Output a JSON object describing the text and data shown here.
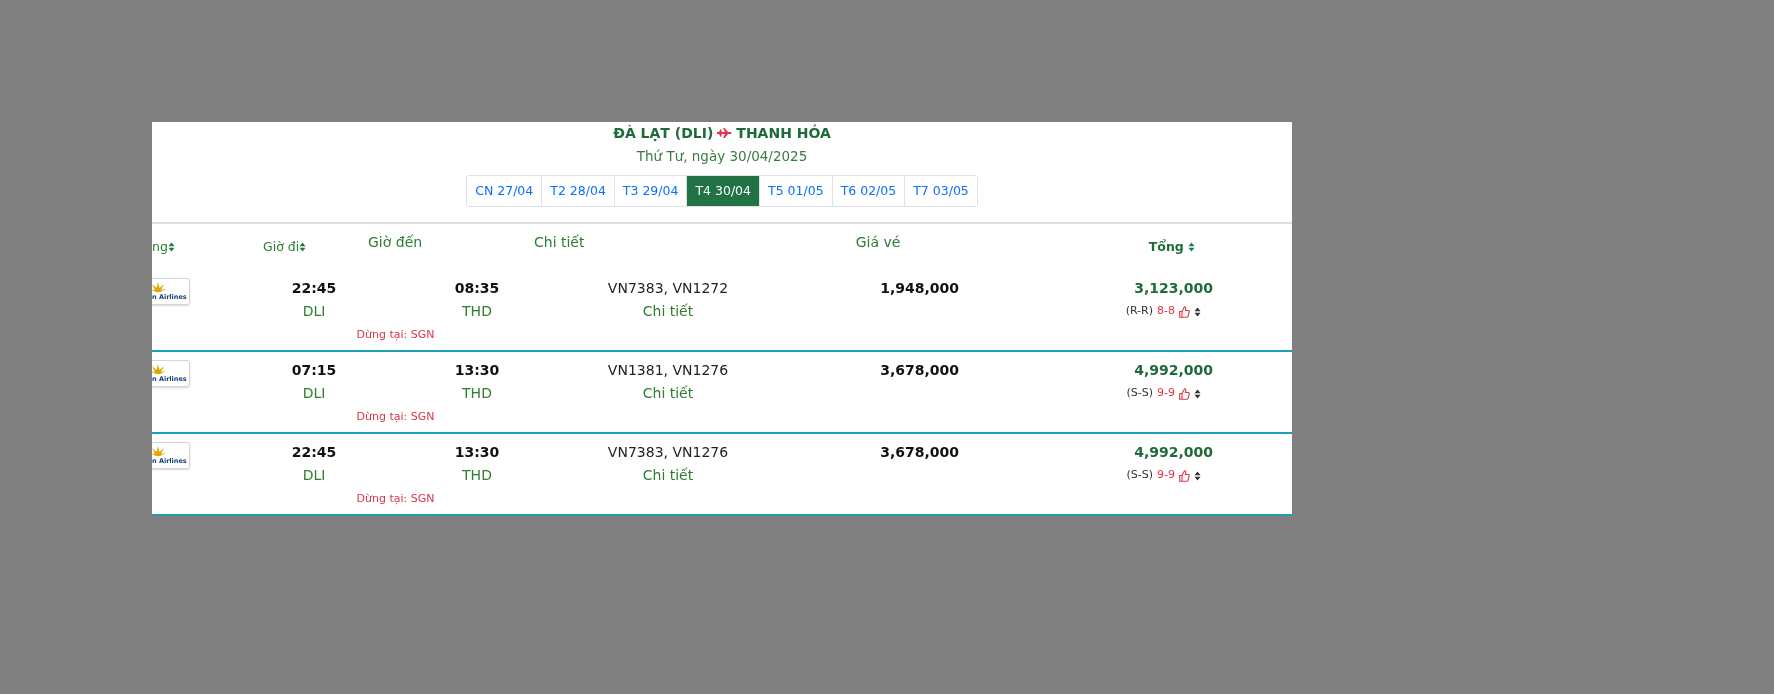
{
  "route": {
    "origin": "ĐÀ LẠT (DLI)",
    "destination": "THANH HÓA"
  },
  "date": "Thứ Tư, ngày 30/04/2025",
  "days": [
    {
      "label": "CN 27/04",
      "selected": false
    },
    {
      "label": "T2 28/04",
      "selected": false
    },
    {
      "label": "T3 29/04",
      "selected": false
    },
    {
      "label": "T4 30/04",
      "selected": true
    },
    {
      "label": "T5 01/05",
      "selected": false
    },
    {
      "label": "T6 02/05",
      "selected": false
    },
    {
      "label": "T7 03/05",
      "selected": false
    }
  ],
  "columns": [
    {
      "label": "ng",
      "sortable": true,
      "bold": false
    },
    {
      "label": "Giờ đi",
      "sortable": true,
      "bold": false
    },
    {
      "label": "Giờ đến",
      "sortable": false,
      "bold": false
    },
    {
      "label": "Chi tiết",
      "sortable": false,
      "bold": false
    },
    {
      "label": "Giá vé",
      "sortable": false,
      "bold": false
    },
    {
      "label": "Tổng",
      "sortable": true,
      "bold": true
    }
  ],
  "flights": [
    {
      "logo_text": "n Airlines",
      "departure_time": "22:45",
      "origin": "DLI",
      "arrival_time": "08:35",
      "destination": "THD",
      "stop": "Dừng tại: SGN",
      "flight_numbers": "VN7383, VN1272",
      "details_link": "Chi tiết",
      "fare": "1,948,000",
      "total": "3,123,000",
      "fare_class": "(R-R)",
      "seats": "8-8"
    },
    {
      "logo_text": "n Airlines",
      "departure_time": "07:15",
      "origin": "DLI",
      "arrival_time": "13:30",
      "destination": "THD",
      "stop": "Dừng tại: SGN",
      "flight_numbers": "VN1381, VN1276",
      "details_link": "Chi tiết",
      "fare": "3,678,000",
      "total": "4,992,000",
      "fare_class": "(S-S)",
      "seats": "9-9"
    },
    {
      "logo_text": "n Airlines",
      "departure_time": "22:45",
      "origin": "DLI",
      "arrival_time": "13:30",
      "destination": "THD",
      "stop": "Dừng tại: SGN",
      "flight_numbers": "VN7383, VN1276",
      "details_link": "Chi tiết",
      "fare": "3,678,000",
      "total": "4,992,000",
      "fare_class": "(S-S)",
      "seats": "9-9"
    }
  ]
}
